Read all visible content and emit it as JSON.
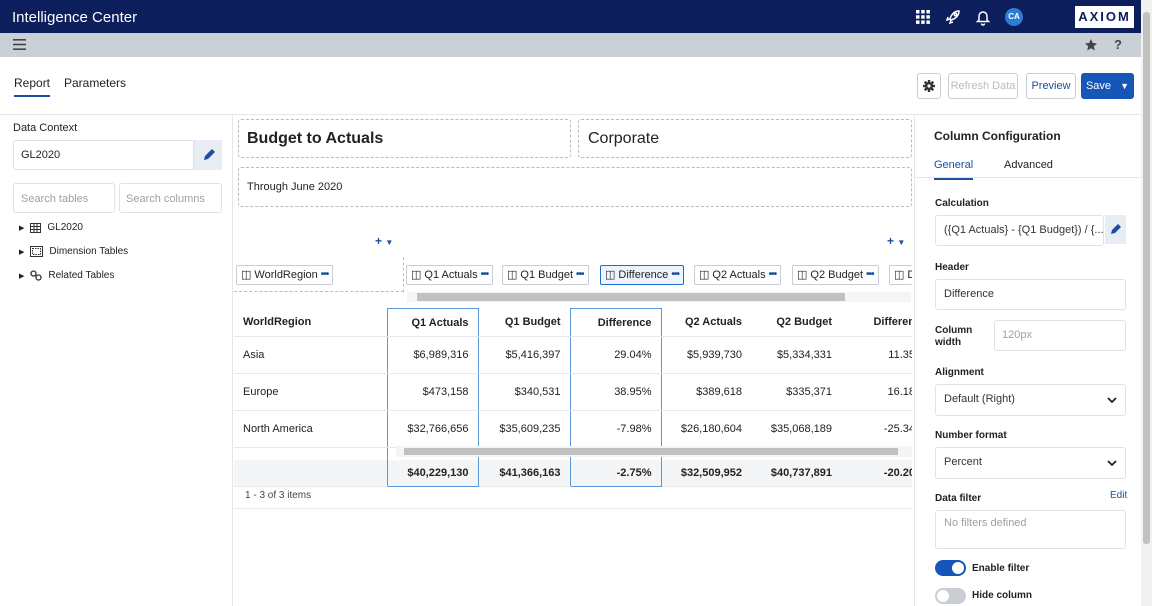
{
  "app": {
    "title": "Intelligence Center",
    "logo": "AXIOM",
    "avatar": "CA"
  },
  "header_tabs": [
    {
      "label": "Report",
      "active": true
    },
    {
      "label": "Parameters",
      "active": false
    }
  ],
  "toolbar": {
    "refresh_label": "Refresh Data",
    "preview_label": "Preview",
    "save_label": "Save"
  },
  "data_context": {
    "label": "Data Context",
    "value": "GL2020",
    "search_tables_placeholder": "Search tables",
    "search_columns_placeholder": "Search columns",
    "tree": [
      {
        "label": "GL2020",
        "icon": "table-icon"
      },
      {
        "label": "Dimension Tables",
        "icon": "dimension-icon"
      },
      {
        "label": "Related Tables",
        "icon": "link-icon"
      }
    ]
  },
  "report": {
    "title": "Budget to Actuals",
    "subtitle": "Corporate",
    "through": "Through June 2020",
    "group_column": "WorldRegion",
    "column_chips": [
      "Q1 Actuals",
      "Q1 Budget",
      "Difference",
      "Q2 Actuals",
      "Q2 Budget",
      "Di"
    ]
  },
  "table": {
    "headers": [
      "WorldRegion",
      "Q1 Actuals",
      "Q1 Budget",
      "Difference",
      "Q2 Actuals",
      "Q2 Budget",
      "Differen"
    ],
    "rows": [
      [
        "Asia",
        "$6,989,316",
        "$5,416,397",
        "29.04%",
        "$5,939,730",
        "$5,334,331",
        "11.35"
      ],
      [
        "Europe",
        "$473,158",
        "$340,531",
        "38.95%",
        "$389,618",
        "$335,371",
        "16.18"
      ],
      [
        "North America",
        "$32,766,656",
        "$35,609,235",
        "-7.98%",
        "$26,180,604",
        "$35,068,189",
        "-25.34"
      ]
    ],
    "totals": [
      "",
      "$40,229,130",
      "$41,366,163",
      "-2.75%",
      "$32,509,952",
      "$40,737,891",
      "-20.20"
    ],
    "pager": "1 - 3 of 3 items"
  },
  "column_config": {
    "title": "Column Configuration",
    "tabs": [
      "General",
      "Advanced"
    ],
    "calculation_label": "Calculation",
    "calculation_value": "({Q1 Actuals} - {Q1 Budget}) / {...",
    "header_label": "Header",
    "header_value": "Difference",
    "width_label_1": "Column",
    "width_label_2": "width",
    "width_placeholder": "120px",
    "alignment_label": "Alignment",
    "alignment_value": "Default (Right)",
    "number_format_label": "Number format",
    "number_format_value": "Percent",
    "data_filter_label": "Data filter",
    "data_filter_edit": "Edit",
    "data_filter_placeholder": "No filters defined",
    "enable_filter_label": "Enable filter",
    "enable_filter_on": true,
    "hide_column_label": "Hide column",
    "hide_column_on": false
  },
  "colors": {
    "topbar": "#0c1e5b",
    "accent": "#1656b8",
    "selection": "#5b97dd"
  }
}
